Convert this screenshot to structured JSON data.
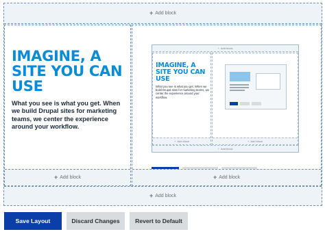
{
  "layout_builder": {
    "add_block_label": "Add block",
    "add_block_icon": "plus-icon",
    "accent_color": "#0a8bd8",
    "primary_color": "#0a3ea8"
  },
  "left_region": {
    "headline": "IMAGINE, A SITE YOU CAN USE",
    "body": "What you see is what you get. When we build Drupal sites for marketing teams, we center the experience around your workflow."
  },
  "preview": {
    "headline": "IMAGINE, A SITE YOU CAN USE",
    "body": "What you see is what you get. When we build Drupal sites for marketing teams, we center the experience around your workflow.",
    "add_block_label": "Add block",
    "buttons": {
      "save": "Save Layout",
      "discard": "Discard Changes",
      "revert": "Revert to Default"
    }
  },
  "actions": {
    "save": "Save Layout",
    "discard": "Discard Changes",
    "revert": "Revert to Default"
  }
}
